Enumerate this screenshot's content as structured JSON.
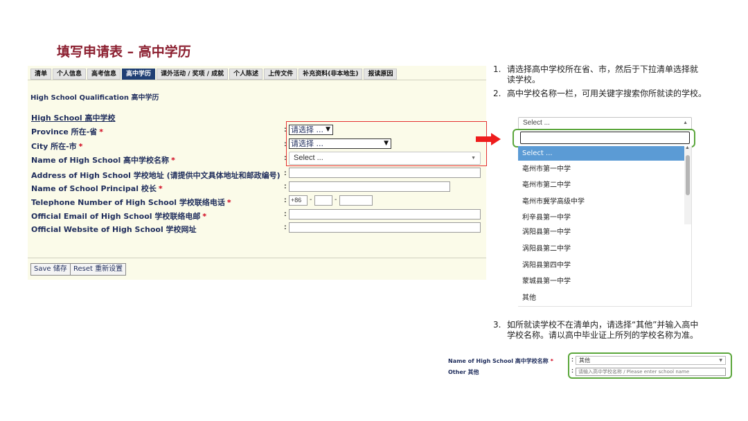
{
  "slide_title": "填写申请表 – 高中学历",
  "tabs": [
    "清单",
    "个人信息",
    "高考信息",
    "高中学历",
    "课外活动 / 奖项 / 成就",
    "个人陈述",
    "上传文件",
    "补充资料(非本地生)",
    "报读原因"
  ],
  "active_tab": "高中学历",
  "form": {
    "section_title": "High School Qualification 高中学历",
    "group_title": "High School 高中学校",
    "rows": [
      {
        "label": "Province 所在-省",
        "required": true
      },
      {
        "label": "City 所在-市",
        "required": true
      },
      {
        "label": "Name of High School 高中学校名称",
        "required": true
      },
      {
        "label": "Address of High School 学校地址 (请提供中文具体地址和邮政编号)",
        "required": false
      },
      {
        "label": "Name of School Principal 校长",
        "required": true
      },
      {
        "label": "Telephone Number of High School 学校联络电话",
        "required": true
      },
      {
        "label": "Official Email of High School 学校联络电邮",
        "required": true
      },
      {
        "label": "Official Website of High School 学校网址",
        "required": false
      }
    ],
    "required_mark": "*",
    "colon": ":",
    "province_select": "请选择 ...",
    "city_select": "请选择 ...",
    "school_select": "Select ...",
    "phone_prefix": "+86",
    "phone_sep": "-",
    "save_button": "Save 储存",
    "reset_button": "Reset 重新设置"
  },
  "instructions": [
    {
      "num": "1.",
      "text": "请选择高中学校所在省、市，然后于下拉清单选择就",
      "text2": "读学校。"
    },
    {
      "num": "2.",
      "text": "高中学校名称一栏，可用关键字搜索你所就读的学校。"
    },
    {
      "num": "3.",
      "text": "如所就读学校不在清单内，请选择“其他”并输入高中",
      "text2": "学校名称。请以高中毕业证上所列的学校名称为准。"
    }
  ],
  "dropdown": {
    "header": "Select ...",
    "options": [
      "Select ...",
      "亳州市第一中学",
      "亳州市第二中学",
      "亳州市冀学高级中学",
      "利辛县第一中学",
      "涡阳县第一中学",
      "涡阳县第二中学",
      "涡阳县第四中学",
      "蒙城县第一中学",
      "其他"
    ],
    "highlighted": "Select ..."
  },
  "mini_form": {
    "school_label": "Name of High School 高中学校名称",
    "school_value": "其他",
    "other_label": "Other 其他",
    "other_placeholder": "请输入高中学校名称 / Please enter school name"
  },
  "colors": {
    "title": "#8b1e2f",
    "form_bg": "#fbfbe9",
    "active_tab": "#1f3f74",
    "highlight_box_red": "#e53030",
    "highlight_box_green": "#5aa63a",
    "option_highlight": "#5b9bd5"
  }
}
